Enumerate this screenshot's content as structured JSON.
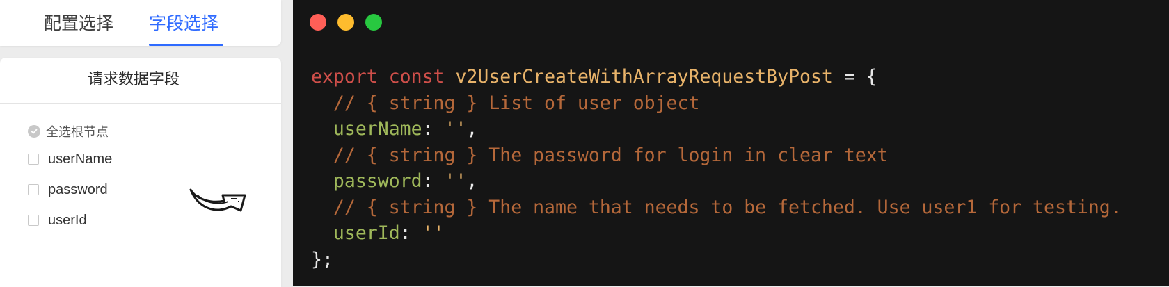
{
  "tabs": {
    "config_label": "配置选择",
    "fields_label": "字段选择",
    "active": "fields",
    "active_color": "#2f6bff"
  },
  "fields_panel": {
    "title": "请求数据字段",
    "select_all_label": "全选根节点",
    "fields": [
      {
        "label": "userName",
        "checked": false
      },
      {
        "label": "password",
        "checked": false
      },
      {
        "label": "userId",
        "checked": false
      }
    ],
    "arrow_icon": "curved-arrow-right-icon"
  },
  "code_window": {
    "window_buttons": [
      "close-dot",
      "minimize-dot",
      "maximize-dot"
    ],
    "line1": {
      "keyword1": "export",
      "keyword2": "const",
      "name": "v2UserCreateWithArrayRequestByPost",
      "rest": " = {"
    },
    "comment1": "// { string } List of user object",
    "prop1": {
      "name": "userName",
      "value": "''",
      "tail": ","
    },
    "comment2": "// { string } The password for login in clear text",
    "prop2": {
      "name": "password",
      "value": "''",
      "tail": ","
    },
    "comment3": "// { string } The name that needs to be fetched. Use user1 for testing.",
    "prop3": {
      "name": "userId",
      "value": "''",
      "tail": ""
    },
    "closing": "};",
    "colors": {
      "background": "#151515",
      "keyword": "#cf4f4a",
      "identifier": "#e8b36a",
      "comment": "#b5683a",
      "property": "#9fb85a"
    }
  }
}
